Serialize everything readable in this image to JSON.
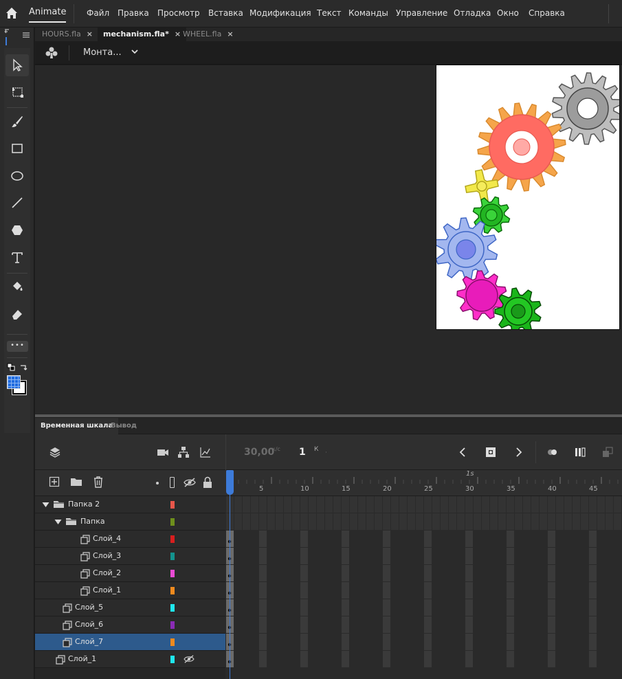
{
  "app": {
    "name": "Animate"
  },
  "menu": [
    "Файл",
    "Правка",
    "Просмотр",
    "Вставка",
    "Модификация",
    "Текст",
    "Команды",
    "Управление",
    "Отладка",
    "Окно",
    "Справка"
  ],
  "tabs": [
    {
      "label": "HOURS.fla",
      "active": false
    },
    {
      "label": "mechanism.fla*",
      "active": true
    },
    {
      "label": "WHEEL.fla",
      "active": false
    }
  ],
  "editbar": {
    "scene": "Монта..."
  },
  "tools": [
    "selection-icon",
    "free-transform-icon",
    "brush-icon",
    "rectangle-icon",
    "oval-icon",
    "line-icon",
    "polystar-icon",
    "text-icon",
    "paint-bucket-icon",
    "eraser-icon"
  ],
  "toolbar_more": "•••",
  "timeline": {
    "tab_timeline": "Временная шкала",
    "tab_output": "Вывод",
    "fps": "30,00",
    "fps_unit": "к/с",
    "frame": "1",
    "frame_unit": "К",
    "frame_sep": "·",
    "second_label": "1s",
    "ruler": [
      "5",
      "10",
      "15",
      "20",
      "25",
      "30",
      "35",
      "40",
      "45"
    ],
    "layers": [
      {
        "name": "Папка 2",
        "type": "folder",
        "depth": 0,
        "expanded": true,
        "color": "#e8564a"
      },
      {
        "name": "Папка",
        "type": "folder",
        "depth": 1,
        "expanded": true,
        "color": "#6e8f1c"
      },
      {
        "name": "Слой_4",
        "type": "layer",
        "depth": 2,
        "color": "#d81e1e"
      },
      {
        "name": "Слой_3",
        "type": "layer",
        "depth": 2,
        "color": "#13928d"
      },
      {
        "name": "Слой_2",
        "type": "layer",
        "depth": 2,
        "color": "#ea4bd4"
      },
      {
        "name": "Слой_1",
        "type": "layer",
        "depth": 2,
        "color": "#f08a1e"
      },
      {
        "name": "Слой_5",
        "type": "layer",
        "depth": 1,
        "color": "#1fe8ee"
      },
      {
        "name": "Слой_6",
        "type": "layer",
        "depth": 1,
        "color": "#8a2bb5"
      },
      {
        "name": "Слой_7",
        "type": "layer",
        "depth": 1,
        "color": "#f08a1e",
        "selected": true
      },
      {
        "name": "Слой_1",
        "type": "layer",
        "depth": 0,
        "color": "#1fe8ee",
        "hidden": true
      }
    ]
  }
}
